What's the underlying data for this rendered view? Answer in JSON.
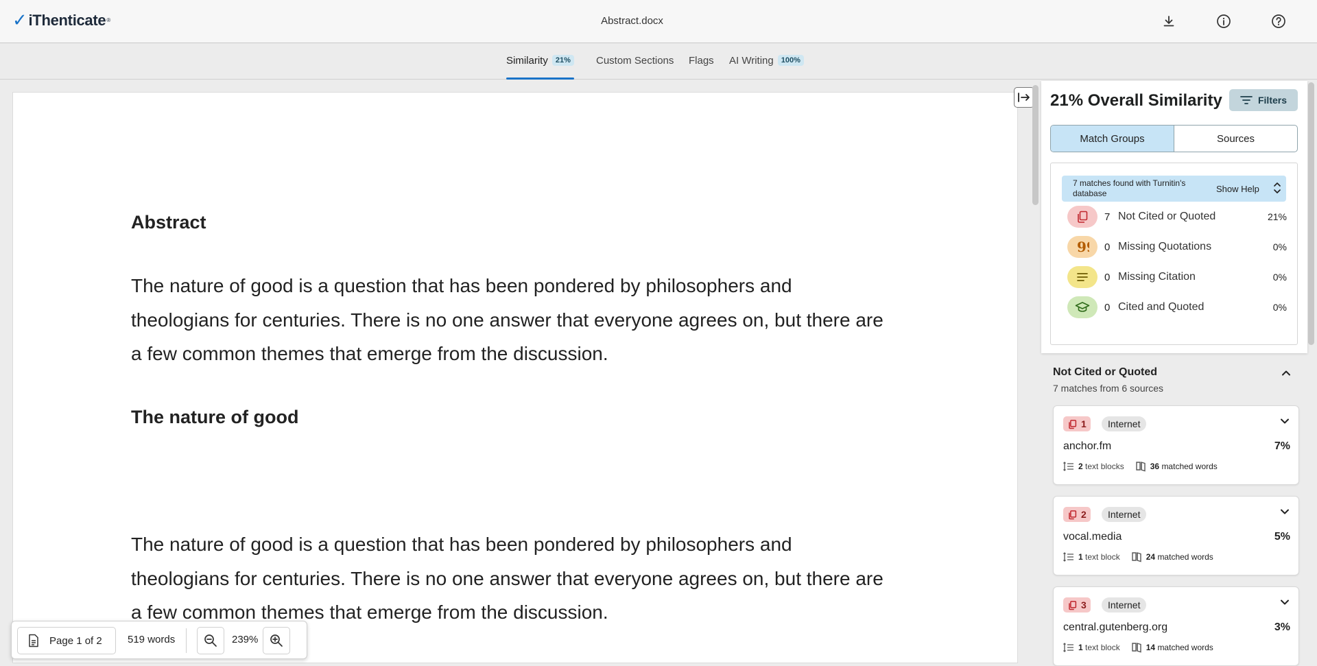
{
  "app": {
    "logo_text": "iThenticate",
    "logo_mark": "®",
    "document_title": "Abstract.docx"
  },
  "header_icons": [
    "download-icon",
    "info-icon",
    "help-icon"
  ],
  "tabs": [
    {
      "label": "Similarity",
      "badge": "21%",
      "active": true
    },
    {
      "label": "Custom Sections",
      "badge": null,
      "active": false
    },
    {
      "label": "Flags",
      "badge": null,
      "active": false
    },
    {
      "label": "AI Writing",
      "badge": "100%",
      "active": false
    }
  ],
  "document": {
    "heading1": "Abstract",
    "para1": "The nature of good is a question that has been pondered by philosophers and theologians for centuries. There is no one answer that everyone agrees on, but there are a few common themes that emerge from the discussion.",
    "heading2": "The nature of good",
    "para2": "The nature of good is a question that has been pondered by philosophers and theologians for centuries. There is no one answer that everyone agrees on, but there are a few common themes that emerge from the discussion."
  },
  "bottom_bar": {
    "page_label": "Page 1 of 2",
    "word_count": "519 words",
    "zoom": "239%"
  },
  "panel": {
    "title": "21% Overall Similarity",
    "filters_label": "Filters",
    "segments": {
      "match_groups": "Match Groups",
      "sources": "Sources"
    },
    "help_text": "7 matches found with Turnitin's database",
    "show_help": "Show Help",
    "categories": [
      {
        "count": "7",
        "label": "Not Cited or Quoted",
        "pct": "21%",
        "color": "#f6c8c8",
        "icon": "copy-icon"
      },
      {
        "count": "0",
        "label": "Missing Quotations",
        "pct": "0%",
        "color": "#f8d7a8",
        "icon": "quote-icon"
      },
      {
        "count": "0",
        "label": "Missing Citation",
        "pct": "0%",
        "color": "#f3e58a",
        "icon": "lines-icon"
      },
      {
        "count": "0",
        "label": "Cited and Quoted",
        "pct": "0%",
        "color": "#cfe8b8",
        "icon": "graduation-cap-icon"
      }
    ],
    "group": {
      "title": "Not Cited or Quoted",
      "subtitle": "7 matches from 6 sources"
    },
    "sources": [
      {
        "num": "1",
        "type": "Internet",
        "name": "anchor.fm",
        "pct": "7%",
        "blocks_n": "2",
        "blocks_l": "text blocks",
        "words_n": "36",
        "words_l": "matched words"
      },
      {
        "num": "2",
        "type": "Internet",
        "name": "vocal.media",
        "pct": "5%",
        "blocks_n": "1",
        "blocks_l": "text block",
        "words_n": "24",
        "words_l": "matched words"
      },
      {
        "num": "3",
        "type": "Internet",
        "name": "central.gutenberg.org",
        "pct": "3%",
        "blocks_n": "1",
        "blocks_l": "text block",
        "words_n": "14",
        "words_l": "matched words"
      }
    ]
  }
}
